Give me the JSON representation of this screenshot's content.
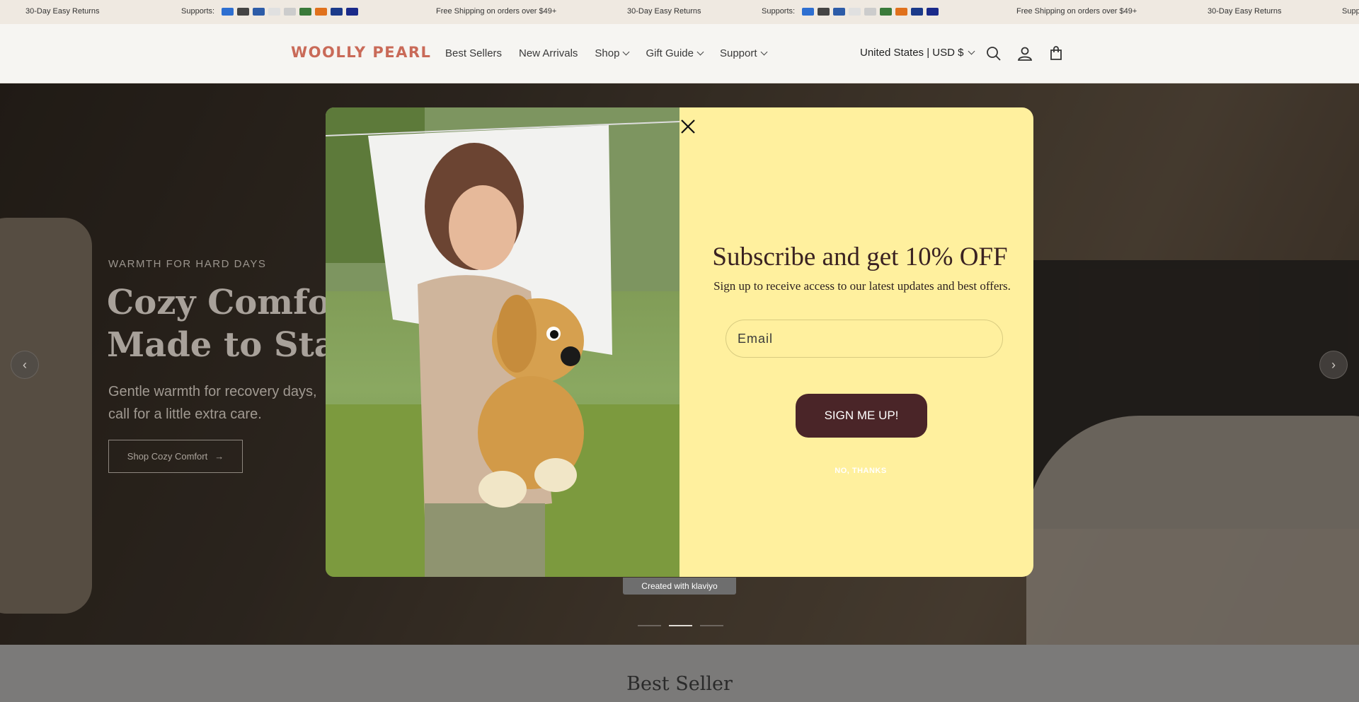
{
  "announcement": {
    "items": [
      {
        "type": "text",
        "text": "30-Day Easy Returns"
      },
      {
        "type": "payments",
        "label": "Supports:"
      },
      {
        "type": "text",
        "text": "Free Shipping on orders over $49+"
      },
      {
        "type": "text",
        "text": "30-Day Easy Returns"
      },
      {
        "type": "payments",
        "label": "Supports:"
      },
      {
        "type": "text",
        "text": "Free Shipping on orders over $49+"
      },
      {
        "type": "text",
        "text": "30-Day Easy Returns"
      },
      {
        "type": "payments",
        "label": "Supports:"
      }
    ],
    "payment_icons": [
      "amex-icon",
      "apple-pay-icon",
      "diners-icon",
      "discover-icon",
      "google-pay-icon",
      "jcb-icon",
      "mastercard-icon",
      "paypal-icon",
      "visa-icon"
    ],
    "payment_colors": [
      "#2e6fd1",
      "#444444",
      "#2d5ca8",
      "#e0e0e0",
      "#cccccc",
      "#3a7a3a",
      "#e0711c",
      "#1b3a8a",
      "#1a2a8a"
    ]
  },
  "header": {
    "logo": "WOOLLY PEARL",
    "nav": [
      {
        "label": "Best Sellers",
        "dropdown": false
      },
      {
        "label": "New Arrivals",
        "dropdown": false
      },
      {
        "label": "Shop",
        "dropdown": true
      },
      {
        "label": "Gift Guide",
        "dropdown": true
      },
      {
        "label": "Support",
        "dropdown": true
      }
    ],
    "region": "United States | USD $",
    "icons": [
      "search-icon",
      "account-icon",
      "cart-icon"
    ]
  },
  "hero": {
    "eyebrow": "WARMTH FOR HARD DAYS",
    "title_line1": "Cozy Comfort",
    "title_line2": "Made to Stay",
    "subtitle": "Gentle warmth for recovery days, call for a little extra care.",
    "button_label": "Shop Cozy Comfort",
    "prev_icon": "chevron-left-icon",
    "next_icon": "chevron-right-icon",
    "slides_total": 3,
    "slide_active": 2
  },
  "popup": {
    "title": "Subscribe and get 10% OFF",
    "subtitle": "Sign up to receive access to our latest updates and best offers.",
    "email_placeholder": "Email",
    "submit_label": "SIGN ME UP!",
    "dismiss_label": "NO, THANKS",
    "badge": "Created with klaviyo"
  },
  "section": {
    "title": "Best Seller"
  }
}
